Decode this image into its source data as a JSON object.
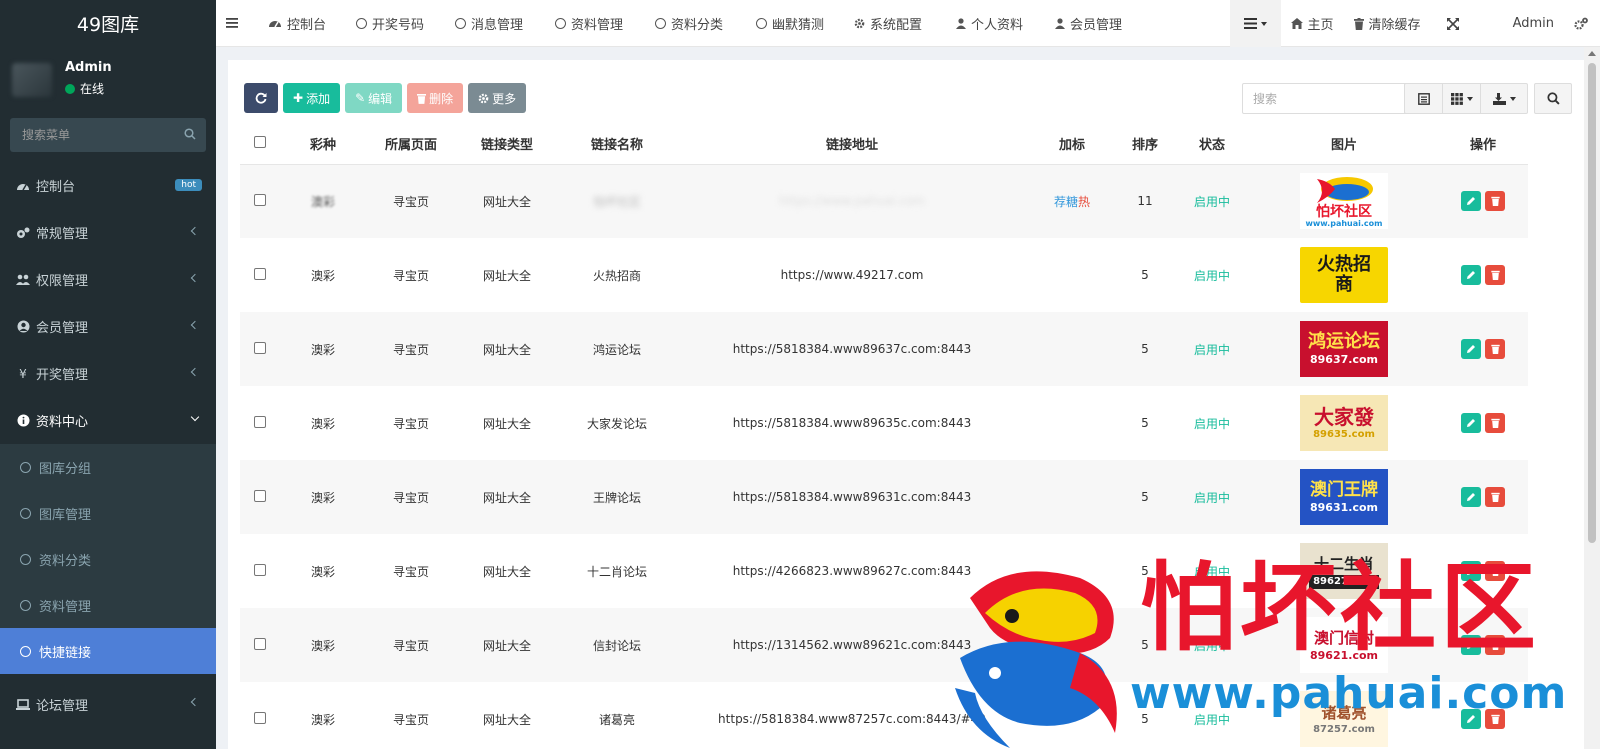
{
  "app": {
    "logo": "49图库"
  },
  "user": {
    "name": "Admin",
    "status": "在线"
  },
  "sidebar": {
    "search_placeholder": "搜索菜单",
    "items": [
      {
        "label": "控制台",
        "badge": "hot"
      },
      {
        "label": "常规管理"
      },
      {
        "label": "权限管理"
      },
      {
        "label": "会员管理"
      },
      {
        "label": "开奖管理"
      },
      {
        "label": "资料中心"
      },
      {
        "label": "论坛管理"
      }
    ],
    "sub_items": [
      {
        "label": "图库分组"
      },
      {
        "label": "图库管理"
      },
      {
        "label": "资料分类"
      },
      {
        "label": "资料管理"
      },
      {
        "label": "快捷链接"
      }
    ]
  },
  "topnav": {
    "tabs": [
      "控制台",
      "开奖号码",
      "消息管理",
      "资料管理",
      "资料分类",
      "幽默猜测",
      "系统配置",
      "个人资料",
      "会员管理"
    ],
    "home": "主页",
    "clear_cache": "清除缓存",
    "admin": "Admin"
  },
  "toolbar": {
    "add": "添加",
    "edit": "编辑",
    "delete": "删除",
    "more": "更多",
    "search_placeholder": "搜索"
  },
  "table": {
    "headers": [
      "彩种",
      "所属页面",
      "链接类型",
      "链接名称",
      "链接地址",
      "加标",
      "排序",
      "状态",
      "图片",
      "操作"
    ],
    "rows": [
      {
        "lottery": "澳彩",
        "page": "寻宝页",
        "type": "网址大全",
        "name": "怕坏社区",
        "url": "https://www.pahuai.com",
        "tag1": "荐",
        "tag2": "糖",
        "tag3": "热",
        "sort": "11",
        "status": "启用中",
        "img_main": "怕坏社区",
        "img_sub": "www.pahuai.com"
      },
      {
        "lottery": "澳彩",
        "page": "寻宝页",
        "type": "网址大全",
        "name": "火热招商",
        "url": "https://www.49217.com",
        "sort": "5",
        "status": "启用中",
        "img_main": "火热招商",
        "img_sub": ""
      },
      {
        "lottery": "澳彩",
        "page": "寻宝页",
        "type": "网址大全",
        "name": "鸿运论坛",
        "url": "https://5818384.www89637c.com:8443",
        "sort": "5",
        "status": "启用中",
        "img_main": "鸿运论坛",
        "img_sub": "89637.com"
      },
      {
        "lottery": "澳彩",
        "page": "寻宝页",
        "type": "网址大全",
        "name": "大家发论坛",
        "url": "https://5818384.www89635c.com:8443",
        "sort": "5",
        "status": "启用中",
        "img_main": "大家發",
        "img_sub": "89635.com"
      },
      {
        "lottery": "澳彩",
        "page": "寻宝页",
        "type": "网址大全",
        "name": "王牌论坛",
        "url": "https://5818384.www89631c.com:8443",
        "sort": "5",
        "status": "启用中",
        "img_main": "澳门王牌",
        "img_sub": "89631.com"
      },
      {
        "lottery": "澳彩",
        "page": "寻宝页",
        "type": "网址大全",
        "name": "十二肖论坛",
        "url": "https://4266823.www89627c.com:8443",
        "sort": "5",
        "status": "启用中",
        "img_main": "十二生肖",
        "img_sub": "89627.com"
      },
      {
        "lottery": "澳彩",
        "page": "寻宝页",
        "type": "网址大全",
        "name": "信封论坛",
        "url": "https://1314562.www89621c.com:8443",
        "sort": "5",
        "status": "启用中",
        "img_main": "澳门信封",
        "img_sub": "89621.com"
      },
      {
        "lottery": "澳彩",
        "page": "寻宝页",
        "type": "网址大全",
        "name": "诸葛亮",
        "url": "https://5818384.www87257c.com:8443/#49",
        "sort": "5",
        "status": "启用中",
        "img_main": "诸葛亮",
        "img_sub": "87257.com"
      }
    ]
  },
  "watermark": {
    "title": "怕坏社区",
    "url": "www.pahuai.com"
  },
  "colors": {
    "sidebar_bg": "#222d32",
    "active": "#4e7fd7",
    "primary": "#18bc9c",
    "danger": "#e74c3c",
    "hot_badge": "#3c8dbc"
  }
}
